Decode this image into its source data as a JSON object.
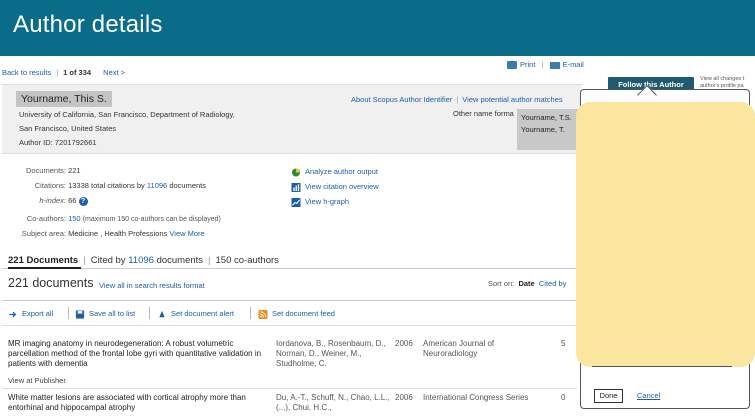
{
  "header": {
    "title": "Author details"
  },
  "nav": {
    "back": "Back to results",
    "position": "1 of 334",
    "next": "Next >"
  },
  "actions": {
    "print": "Print",
    "email": "E-mail"
  },
  "author": {
    "name": "Yourname, This S.",
    "affiliation": "University of California, San Francisco, Department of Radiology, San Francisco, United States",
    "author_id": "Author ID: 7201792661",
    "other_name_label": "Other name forma",
    "other_names": [
      "Yourname, T.S.",
      "Yourname, T."
    ]
  },
  "about_links": {
    "about": "About Scopus Author Identifier",
    "potential": "View potential author matches"
  },
  "metrics": {
    "documents_label": "Documents:",
    "documents_value": "221",
    "citations_label": "Citations:",
    "citations_pre": "13338 total citations by",
    "citations_link": "11096",
    "citations_post": "documents",
    "hindex_label": "h-index:",
    "hindex_value": "66",
    "coauthors_label": "Co-authors:",
    "coauthors_link": "150",
    "coauthors_note": "(maximum 150 co-authors can be displayed)",
    "subject_label": "Subject area:",
    "subject_value": "Medicine ,  Health Professions",
    "subject_more": "View More"
  },
  "tools": {
    "analyze": "Analyze author output",
    "citation": "View citation overview",
    "hgraph": "View h-graph"
  },
  "tabs": {
    "documents": "221 Documents",
    "cited_pre": "Cited by",
    "cited_link": "11096",
    "cited_post": "documents",
    "coauthors": "150 co-authors"
  },
  "results": {
    "count": "221 documents",
    "view_all": "View all in search results format",
    "sort_label": "Sort on:",
    "sort_date": "Date",
    "sort_cited": "Cited by"
  },
  "toolbar": {
    "export": "Export all",
    "save": "Save all to list",
    "alert": "Set document alert",
    "feed": "Set document feed"
  },
  "documents": [
    {
      "title": "MR imaging anatomy in neurodegeneration: A robust volumetric parcellation method of the frontal lobe gyri with quantitative validation in patients with dementia",
      "authors": "Iordanova, B., Rosenbaum, D., Norman, D., Weiner, M., Studholme, C.",
      "year": "2006",
      "source": "American Journal of Neuroradiology",
      "cited": "5",
      "publisher_link": "View at Publisher"
    },
    {
      "title": "White matter lesions are associated with cortical atrophy more than entorhinal and hippocampal atrophy",
      "authors": "Du, A.-T., Schuff, N., Chao, L.L., (...), Chui, H.C.,",
      "year": "2006",
      "source": "International Congress Series",
      "cited": "0"
    }
  ],
  "follow": {
    "button": "Follow this Author",
    "note": "View all changes t author's profile pa",
    "done": "Done",
    "cancel": "Cancel"
  },
  "colors": {
    "header_bg": "#0b6c8a",
    "link": "#1a5ea8",
    "follow_bg": "#1f5a6e",
    "sticky": "#fbe6a0"
  }
}
